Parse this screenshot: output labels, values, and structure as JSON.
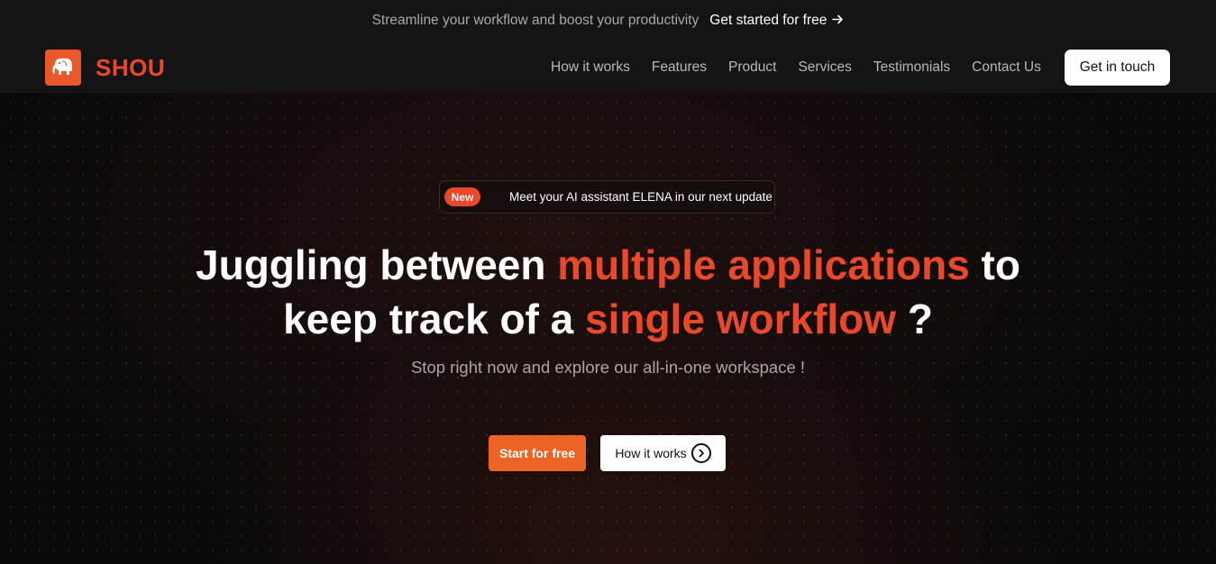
{
  "topbar": {
    "promo": "Streamline your workflow and boost your productivity",
    "cta": "Get started for free",
    "cta_icon": "arrow-right-icon"
  },
  "nav": {
    "logo_text": "SHOU",
    "logo_icon": "elephant-icon",
    "links": [
      "How it works",
      "Features",
      "Product",
      "Services",
      "Testimonials",
      "Contact Us"
    ],
    "button": "Get in touch"
  },
  "announcement": {
    "badge": "New",
    "text": "Meet your AI assistant ELENA in our next update"
  },
  "hero": {
    "line1_a": "Juggling between ",
    "line1_accent": "multiple applications",
    "line1_b": " to",
    "line2_a": "keep track of a ",
    "line2_accent": "single workflow",
    "line2_b": " ?",
    "subtitle": "Stop right now and explore our all-in-one workspace !"
  },
  "buttons": {
    "start": "Start for free",
    "how": "How it works",
    "how_icon": "chevron-right-circle-icon"
  },
  "colors": {
    "accent": "#e9482b",
    "cta_orange": "#ec6326",
    "background": "#0d0b0b"
  }
}
